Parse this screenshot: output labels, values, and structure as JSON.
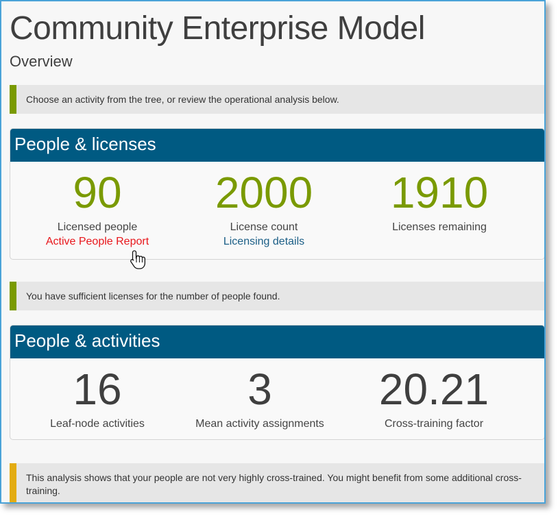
{
  "page": {
    "title": "Community Enterprise Model",
    "subtitle": "Overview"
  },
  "notices": {
    "intro": "Choose an activity from the tree, or review the operational analysis below.",
    "licenses_ok": "You have sufficient licenses for the number of people found.",
    "cross_training": "This analysis shows that your people are not very highly cross-trained. You might benefit from some additional cross-training."
  },
  "people_licenses": {
    "title": "People & licenses",
    "stats": [
      {
        "value": "90",
        "label": "Licensed people",
        "link": "Active People Report"
      },
      {
        "value": "2000",
        "label": "License count",
        "link": "Licensing details"
      },
      {
        "value": "1910",
        "label": "Licenses remaining"
      }
    ]
  },
  "people_activities": {
    "title": "People & activities",
    "stats": [
      {
        "value": "16",
        "label": "Leaf-node activities"
      },
      {
        "value": "3",
        "label": "Mean activity assignments"
      },
      {
        "value": "20.21",
        "label": "Cross-training factor"
      }
    ]
  },
  "colors": {
    "header_blue": "#005a82",
    "value_green": "#7a9a01",
    "notice_green": "#7a9a01",
    "notice_amber": "#e3ac12",
    "link_red": "#e8161b",
    "link_blue": "#1a5e86"
  },
  "icons": {
    "cursor": "hand-pointer-icon"
  }
}
